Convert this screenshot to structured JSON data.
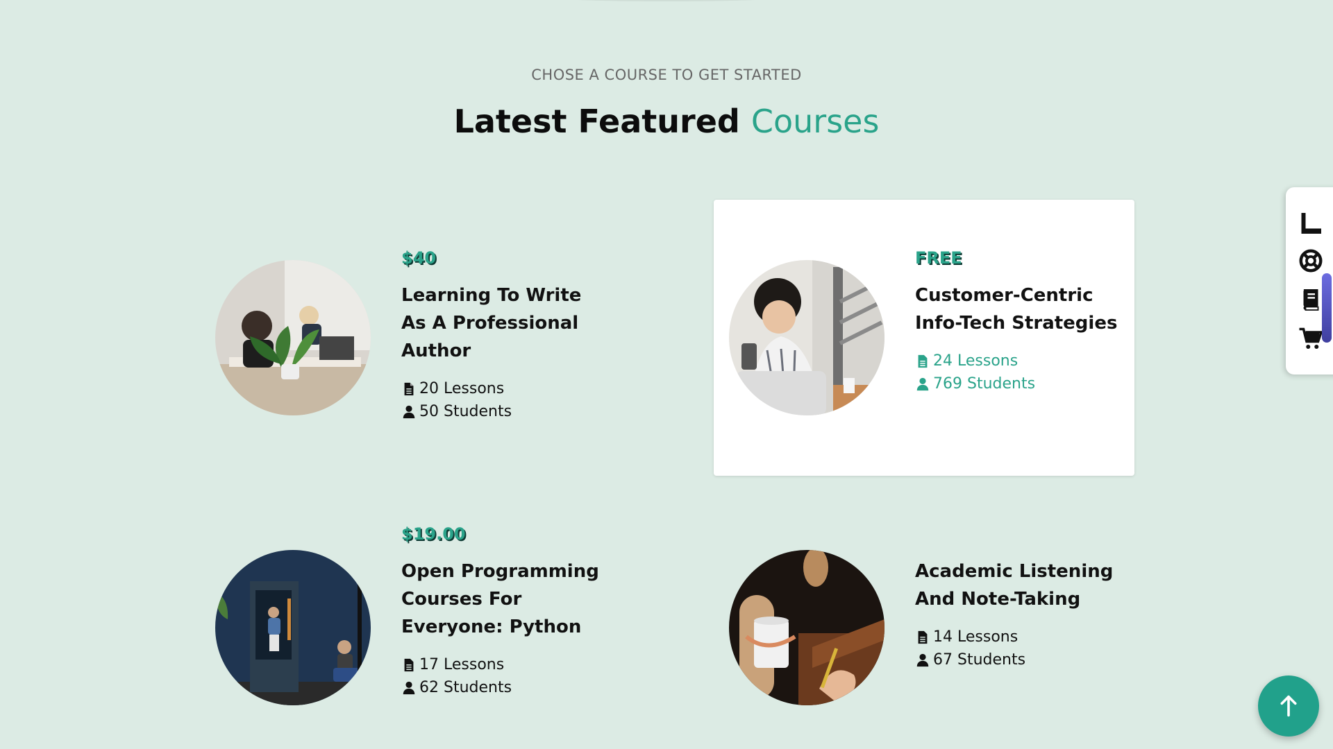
{
  "section": {
    "eyebrow": "CHOSE A COURSE TO GET STARTED",
    "heading_main": "Latest Featured",
    "heading_accent": "Courses"
  },
  "courses": [
    {
      "price": "$40",
      "title": "Learning To Write As A Professional Author",
      "lessons": "20 Lessons",
      "students": "50 Students",
      "image": "office-workers-photo"
    },
    {
      "price": "FREE",
      "title": "Customer-Centric Info-Tech Strategies",
      "lessons": "24 Lessons",
      "students": "769 Students",
      "image": "woman-with-phone-laptop-photo"
    },
    {
      "price": "$19.00",
      "title": "Open Programming Courses For Everyone: Python",
      "lessons": "17 Lessons",
      "students": "62 Students",
      "image": "blue-booth-office-photo"
    },
    {
      "price": "",
      "title": "Academic Listening And Note-Taking",
      "lessons": "14 Lessons",
      "students": "67 Students",
      "image": "coffee-cup-writing-photo"
    }
  ],
  "side_panel": {
    "icons": [
      "ruler-icon",
      "lifebuoy-icon",
      "book-icon",
      "cart-icon"
    ]
  },
  "fab": {
    "icon": "arrow-up-icon"
  },
  "colors": {
    "background": "#dcebe4",
    "accent": "#2aa38a",
    "card": "#ffffff"
  }
}
